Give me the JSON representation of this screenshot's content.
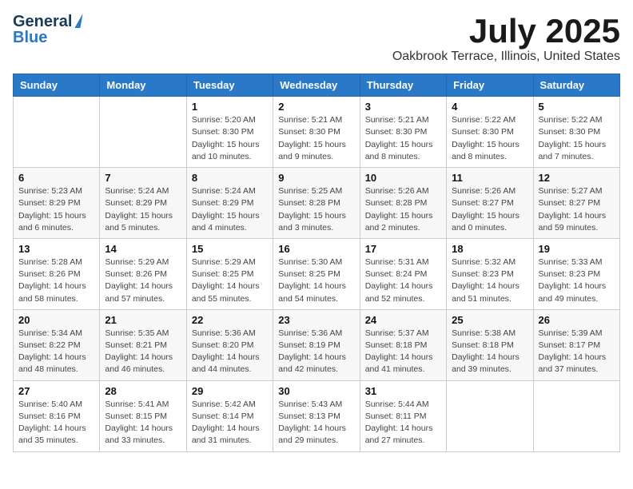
{
  "header": {
    "logo_line1": "General",
    "logo_line2": "Blue",
    "month": "July 2025",
    "location": "Oakbrook Terrace, Illinois, United States"
  },
  "weekdays": [
    "Sunday",
    "Monday",
    "Tuesday",
    "Wednesday",
    "Thursday",
    "Friday",
    "Saturday"
  ],
  "weeks": [
    [
      {
        "day": "",
        "info": ""
      },
      {
        "day": "",
        "info": ""
      },
      {
        "day": "1",
        "info": "Sunrise: 5:20 AM\nSunset: 8:30 PM\nDaylight: 15 hours and 10 minutes."
      },
      {
        "day": "2",
        "info": "Sunrise: 5:21 AM\nSunset: 8:30 PM\nDaylight: 15 hours and 9 minutes."
      },
      {
        "day": "3",
        "info": "Sunrise: 5:21 AM\nSunset: 8:30 PM\nDaylight: 15 hours and 8 minutes."
      },
      {
        "day": "4",
        "info": "Sunrise: 5:22 AM\nSunset: 8:30 PM\nDaylight: 15 hours and 8 minutes."
      },
      {
        "day": "5",
        "info": "Sunrise: 5:22 AM\nSunset: 8:30 PM\nDaylight: 15 hours and 7 minutes."
      }
    ],
    [
      {
        "day": "6",
        "info": "Sunrise: 5:23 AM\nSunset: 8:29 PM\nDaylight: 15 hours and 6 minutes."
      },
      {
        "day": "7",
        "info": "Sunrise: 5:24 AM\nSunset: 8:29 PM\nDaylight: 15 hours and 5 minutes."
      },
      {
        "day": "8",
        "info": "Sunrise: 5:24 AM\nSunset: 8:29 PM\nDaylight: 15 hours and 4 minutes."
      },
      {
        "day": "9",
        "info": "Sunrise: 5:25 AM\nSunset: 8:28 PM\nDaylight: 15 hours and 3 minutes."
      },
      {
        "day": "10",
        "info": "Sunrise: 5:26 AM\nSunset: 8:28 PM\nDaylight: 15 hours and 2 minutes."
      },
      {
        "day": "11",
        "info": "Sunrise: 5:26 AM\nSunset: 8:27 PM\nDaylight: 15 hours and 0 minutes."
      },
      {
        "day": "12",
        "info": "Sunrise: 5:27 AM\nSunset: 8:27 PM\nDaylight: 14 hours and 59 minutes."
      }
    ],
    [
      {
        "day": "13",
        "info": "Sunrise: 5:28 AM\nSunset: 8:26 PM\nDaylight: 14 hours and 58 minutes."
      },
      {
        "day": "14",
        "info": "Sunrise: 5:29 AM\nSunset: 8:26 PM\nDaylight: 14 hours and 57 minutes."
      },
      {
        "day": "15",
        "info": "Sunrise: 5:29 AM\nSunset: 8:25 PM\nDaylight: 14 hours and 55 minutes."
      },
      {
        "day": "16",
        "info": "Sunrise: 5:30 AM\nSunset: 8:25 PM\nDaylight: 14 hours and 54 minutes."
      },
      {
        "day": "17",
        "info": "Sunrise: 5:31 AM\nSunset: 8:24 PM\nDaylight: 14 hours and 52 minutes."
      },
      {
        "day": "18",
        "info": "Sunrise: 5:32 AM\nSunset: 8:23 PM\nDaylight: 14 hours and 51 minutes."
      },
      {
        "day": "19",
        "info": "Sunrise: 5:33 AM\nSunset: 8:23 PM\nDaylight: 14 hours and 49 minutes."
      }
    ],
    [
      {
        "day": "20",
        "info": "Sunrise: 5:34 AM\nSunset: 8:22 PM\nDaylight: 14 hours and 48 minutes."
      },
      {
        "day": "21",
        "info": "Sunrise: 5:35 AM\nSunset: 8:21 PM\nDaylight: 14 hours and 46 minutes."
      },
      {
        "day": "22",
        "info": "Sunrise: 5:36 AM\nSunset: 8:20 PM\nDaylight: 14 hours and 44 minutes."
      },
      {
        "day": "23",
        "info": "Sunrise: 5:36 AM\nSunset: 8:19 PM\nDaylight: 14 hours and 42 minutes."
      },
      {
        "day": "24",
        "info": "Sunrise: 5:37 AM\nSunset: 8:18 PM\nDaylight: 14 hours and 41 minutes."
      },
      {
        "day": "25",
        "info": "Sunrise: 5:38 AM\nSunset: 8:18 PM\nDaylight: 14 hours and 39 minutes."
      },
      {
        "day": "26",
        "info": "Sunrise: 5:39 AM\nSunset: 8:17 PM\nDaylight: 14 hours and 37 minutes."
      }
    ],
    [
      {
        "day": "27",
        "info": "Sunrise: 5:40 AM\nSunset: 8:16 PM\nDaylight: 14 hours and 35 minutes."
      },
      {
        "day": "28",
        "info": "Sunrise: 5:41 AM\nSunset: 8:15 PM\nDaylight: 14 hours and 33 minutes."
      },
      {
        "day": "29",
        "info": "Sunrise: 5:42 AM\nSunset: 8:14 PM\nDaylight: 14 hours and 31 minutes."
      },
      {
        "day": "30",
        "info": "Sunrise: 5:43 AM\nSunset: 8:13 PM\nDaylight: 14 hours and 29 minutes."
      },
      {
        "day": "31",
        "info": "Sunrise: 5:44 AM\nSunset: 8:11 PM\nDaylight: 14 hours and 27 minutes."
      },
      {
        "day": "",
        "info": ""
      },
      {
        "day": "",
        "info": ""
      }
    ]
  ]
}
